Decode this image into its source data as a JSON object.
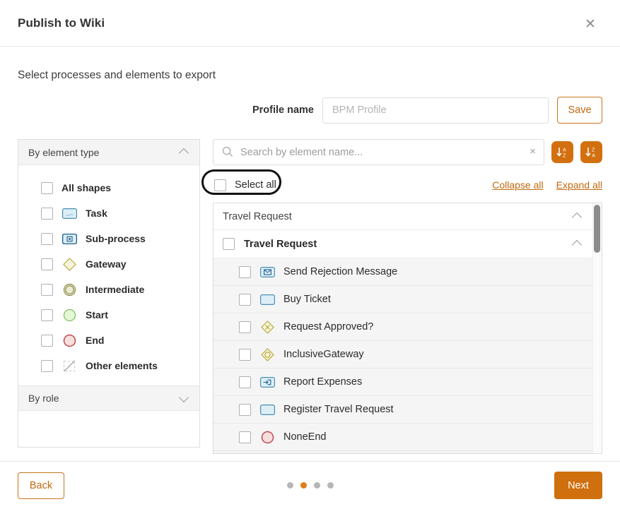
{
  "dialog": {
    "title": "Publish to Wiki",
    "close_icon": "close-icon",
    "subtitle": "Select processes and elements to export"
  },
  "profile": {
    "label": "Profile name",
    "placeholder": "BPM Profile",
    "value": "",
    "save_label": "Save"
  },
  "search": {
    "placeholder": "Search by element name...",
    "value": "",
    "clear_icon": "×",
    "sort_asc_title": "sort-ascending",
    "sort_desc_title": "sort-descending"
  },
  "select_all": {
    "label": "Select all",
    "checked": false,
    "highlighted": true
  },
  "tree_links": {
    "collapse": "Collapse all",
    "expand": "Expand all"
  },
  "filters": {
    "section_element_type": {
      "title": "By element type",
      "expanded": true,
      "items": [
        {
          "label": "All shapes",
          "icon": "none",
          "checked": false
        },
        {
          "label": "Task",
          "icon": "task",
          "checked": false
        },
        {
          "label": "Sub-process",
          "icon": "subprocess",
          "checked": false
        },
        {
          "label": "Gateway",
          "icon": "gateway",
          "checked": false
        },
        {
          "label": "Intermediate",
          "icon": "intermediate",
          "checked": false
        },
        {
          "label": "Start",
          "icon": "start",
          "checked": false
        },
        {
          "label": "End",
          "icon": "end",
          "checked": false
        },
        {
          "label": "Other elements",
          "icon": "other",
          "checked": false
        }
      ]
    },
    "section_role": {
      "title": "By role",
      "expanded": false
    }
  },
  "tree": {
    "group_label": "Travel Request",
    "process_label": "Travel Request",
    "process_checked": false,
    "elements": [
      {
        "label": "Send Rejection Message",
        "icon": "send-task",
        "checked": false
      },
      {
        "label": "Buy Ticket",
        "icon": "task",
        "checked": false
      },
      {
        "label": "Request Approved?",
        "icon": "exclusive-gateway",
        "checked": false
      },
      {
        "label": "InclusiveGateway",
        "icon": "inclusive-gateway",
        "checked": false
      },
      {
        "label": "Report Expenses",
        "icon": "receive-task",
        "checked": false
      },
      {
        "label": "Register Travel Request",
        "icon": "task",
        "checked": false
      },
      {
        "label": "NoneEnd",
        "icon": "end-event",
        "checked": false
      }
    ]
  },
  "footer": {
    "back_label": "Back",
    "next_label": "Next",
    "steps_total": 4,
    "current_step": 2
  },
  "colors": {
    "accent": "#cf6f0d",
    "accent_link": "#c0690f",
    "sort_button": "#d2700f",
    "row_background": "#f5f5f5",
    "highlight_ring": "#111111"
  }
}
